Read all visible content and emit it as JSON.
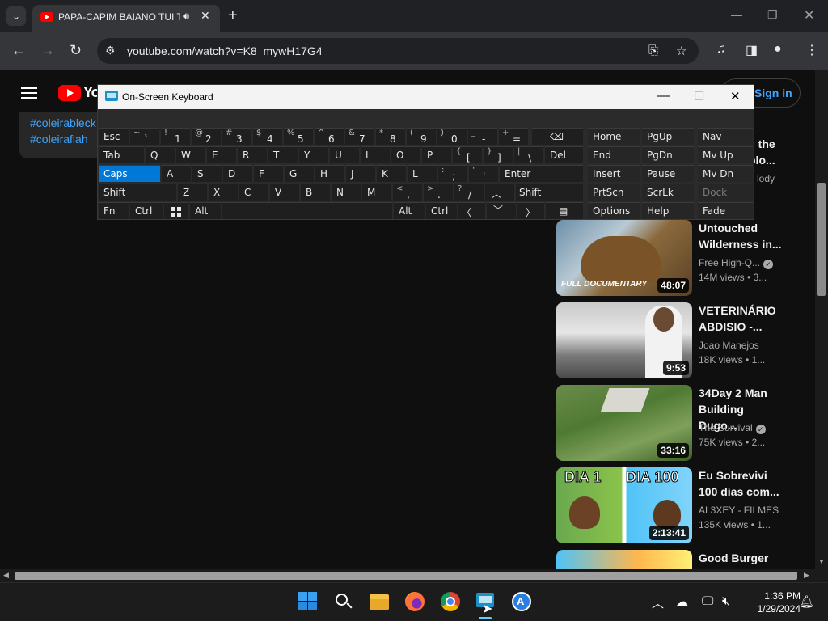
{
  "browser": {
    "tab_title": "PAPA-CAPIM BAIANO TUI T",
    "tab_close": "✕",
    "new_tab": "+",
    "url": "youtube.com/watch?v=K8_mywH17G4"
  },
  "youtube": {
    "logo_text": "Yo",
    "sign_in": "Sign in",
    "hashtags": [
      "#coleirableck",
      "#coleiraflah"
    ],
    "partial_top": {
      "title": "s the\nplo...",
      "channel": "lody"
    },
    "videos": [
      {
        "title": "Untouched Wilderness in...",
        "channel": "Free High-Q...",
        "verified": true,
        "views": "14M views",
        "age": "3...",
        "duration": "48:07",
        "thumb_caption": "FULL DOCUMENTARY"
      },
      {
        "title": "VETERINÁRIO ABDISIO -...",
        "channel": "Joao Manejos",
        "verified": false,
        "views": "18K views",
        "age": "1...",
        "duration": "9:53"
      },
      {
        "title": "34Day 2 Man Building Dugo...",
        "channel": "The Survival",
        "verified": true,
        "views": "75K views",
        "age": "2...",
        "duration": "33:16"
      },
      {
        "title": "Eu Sobrevivi 100 dias com...",
        "channel": "AL3XEY - FILMES",
        "verified": false,
        "views": "135K views",
        "age": "1...",
        "duration": "2:13:41",
        "thumb_left": "DIA 1",
        "thumb_right": "DIA 100"
      },
      {
        "title": "Good Burger"
      }
    ]
  },
  "osk": {
    "title": "On-Screen Keyboard",
    "keys": {
      "esc": "Esc",
      "tab": "Tab",
      "caps": "Caps",
      "shift": "Shift",
      "fn": "Fn",
      "ctrl": "Ctrl",
      "alt": "Alt",
      "del": "Del",
      "enter": "Enter",
      "shift_r": "Shift",
      "alt_r": "Alt",
      "ctrl_r": "Ctrl",
      "home": "Home",
      "pgup": "PgUp",
      "nav": "Nav",
      "end": "End",
      "pgdn": "PgDn",
      "mvup": "Mv Up",
      "insert": "Insert",
      "pause": "Pause",
      "mvdn": "Mv Dn",
      "prtscn": "PrtScn",
      "scrlk": "ScrLk",
      "dock": "Dock",
      "options": "Options",
      "help": "Help",
      "fade": "Fade",
      "q": "Q",
      "w": "W",
      "e": "E",
      "r": "R",
      "t": "T",
      "y": "Y",
      "u": "U",
      "i": "I",
      "o": "O",
      "p": "P",
      "a": "A",
      "s": "S",
      "d": "D",
      "f": "F",
      "g": "G",
      "h": "H",
      "j": "J",
      "k": "K",
      "l": "L",
      "z": "Z",
      "x": "X",
      "c": "C",
      "v": "V",
      "b": "B",
      "n": "N",
      "m": "M"
    },
    "number_row": [
      {
        "shift": "~",
        "main": "`"
      },
      {
        "shift": "!",
        "main": "1"
      },
      {
        "shift": "@",
        "main": "2"
      },
      {
        "shift": "#",
        "main": "3"
      },
      {
        "shift": "$",
        "main": "4"
      },
      {
        "shift": "%",
        "main": "5"
      },
      {
        "shift": "^",
        "main": "6"
      },
      {
        "shift": "&",
        "main": "7"
      },
      {
        "shift": "*",
        "main": "8"
      },
      {
        "shift": "(",
        "main": "9"
      },
      {
        "shift": ")",
        "main": "0"
      },
      {
        "shift": "_",
        "main": "-"
      },
      {
        "shift": "+",
        "main": "="
      }
    ],
    "punct": {
      "lbracket": {
        "shift": "{",
        "main": "["
      },
      "rbracket": {
        "shift": "}",
        "main": "]"
      },
      "backslash": {
        "shift": "|",
        "main": "\\"
      },
      "semicolon": {
        "shift": ":",
        "main": ";"
      },
      "quote": {
        "shift": "\"",
        "main": "'"
      },
      "comma": {
        "shift": "<",
        "main": ","
      },
      "period": {
        "shift": ">",
        "main": "."
      },
      "slash": {
        "shift": "?",
        "main": "/"
      }
    }
  },
  "taskbar": {
    "time": "1:36 PM",
    "date": "1/29/2024"
  }
}
